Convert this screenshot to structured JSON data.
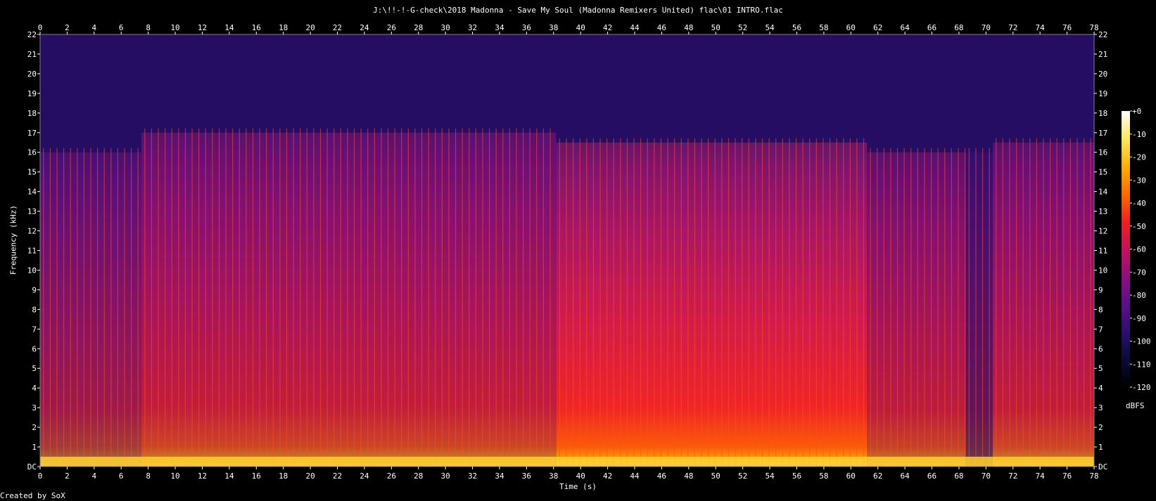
{
  "chart_data": {
    "type": "heatmap",
    "title": "J:\\!!-!-G-check\\2018 Madonna - Save My Soul (Madonna Remixers United) flac\\01 INTRO.flac",
    "xlabel": "Time (s)",
    "ylabel": "Frequency (kHz)",
    "xlim": [
      0,
      78
    ],
    "ylim": [
      0,
      22
    ],
    "x_ticks": [
      "0",
      "2",
      "4",
      "6",
      "8",
      "10",
      "12",
      "14",
      "16",
      "18",
      "20",
      "22",
      "24",
      "26",
      "28",
      "30",
      "32",
      "34",
      "36",
      "38",
      "40",
      "42",
      "44",
      "46",
      "48",
      "50",
      "52",
      "54",
      "56",
      "58",
      "60",
      "62",
      "64",
      "66",
      "68",
      "70",
      "72",
      "74",
      "76",
      "78"
    ],
    "y_ticks": [
      "DC",
      "1",
      "2",
      "3",
      "4",
      "5",
      "6",
      "7",
      "8",
      "9",
      "10",
      "11",
      "12",
      "13",
      "14",
      "15",
      "16",
      "17",
      "18",
      "19",
      "20",
      "21",
      "22"
    ],
    "colorbar": {
      "label": "dBFS",
      "range": [
        -120,
        0
      ],
      "ticks": [
        "+0",
        "-10",
        "-20",
        "-30",
        "-40",
        "-50",
        "-60",
        "-70",
        "-80",
        "-90",
        "-100",
        "-110",
        "-120"
      ]
    },
    "sections": [
      {
        "start": 0,
        "end": 7.5,
        "bandwidth_khz": 16,
        "level_dbfs": -70
      },
      {
        "start": 7.5,
        "end": 38.2,
        "bandwidth_khz": 17,
        "level_dbfs": -62
      },
      {
        "start": 38.2,
        "end": 61.2,
        "bandwidth_khz": 16.5,
        "level_dbfs": -48
      },
      {
        "start": 61.2,
        "end": 68.5,
        "bandwidth_khz": 16,
        "level_dbfs": -64
      },
      {
        "start": 68.5,
        "end": 70.5,
        "bandwidth_khz": 16,
        "level_dbfs": -88
      },
      {
        "start": 70.5,
        "end": 78,
        "bandwidth_khz": 16.5,
        "level_dbfs": -62
      }
    ],
    "colors": {
      "background": "#000000",
      "frame": "#7f7f7f",
      "gradient": [
        "#000000",
        "#0a0a3a",
        "#2c0f6e",
        "#5e0e8a",
        "#8c1080",
        "#c8105a",
        "#f02020",
        "#ff6a00",
        "#ffb000",
        "#ffe860",
        "#ffffff"
      ]
    }
  },
  "footer": "Created by SoX"
}
